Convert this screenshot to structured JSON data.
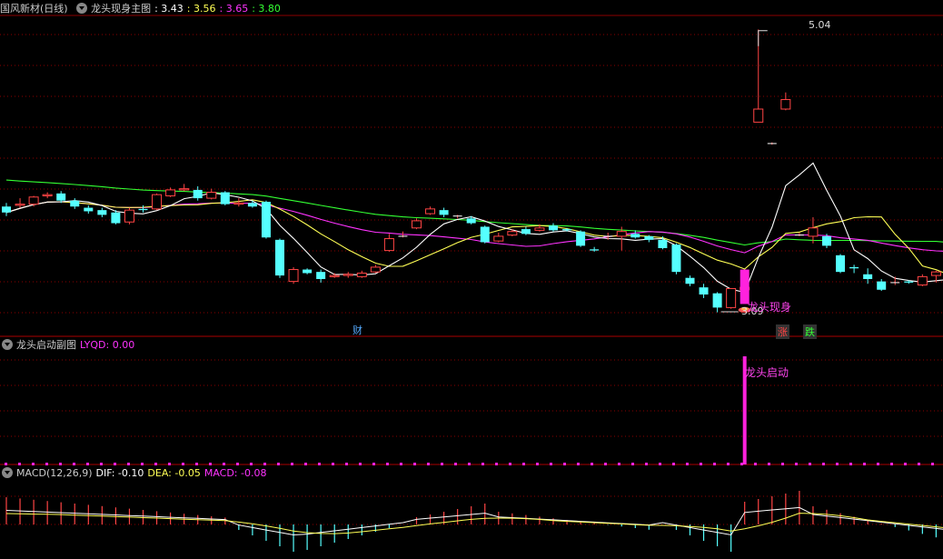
{
  "main_panel": {
    "stock_title": "国风新材(日线)",
    "indicator_name": "龙头现身主图",
    "indicator_values": [
      {
        "text": ": 3.43",
        "color": "#ffffff"
      },
      {
        "text": ": 3.56",
        "color": "#ffff55"
      },
      {
        "text": ": 3.65",
        "color": "#ff33ff"
      },
      {
        "text": ": 3.80",
        "color": "#33ff33"
      }
    ],
    "high_label": "5.04",
    "low_label": "3.09",
    "signal_label": "龙头现身",
    "markers": {
      "cai": "财",
      "zhang": "涨",
      "die": "跌"
    }
  },
  "sub_panel1": {
    "name": "龙头启动副图",
    "value_label": "LYQD: 0.00",
    "signal_label": "龙头启动"
  },
  "macd_panel": {
    "name": "MACD(12,26,9)",
    "dif": "DIF: -0.10",
    "dea": "DEA: -0.05",
    "macd": "MACD: -0.08"
  },
  "colors": {
    "up": "#ff4444",
    "down": "#55ffff",
    "ma1": "#ffffff",
    "ma2": "#ffff55",
    "ma3": "#ff33ff",
    "ma4": "#33ff33",
    "grid": "#8b0000",
    "signal": "#ff22dd"
  },
  "candles": [
    [
      3.55,
      3.5,
      3.58,
      3.47
    ],
    [
      3.56,
      3.57,
      3.62,
      3.54
    ],
    [
      3.57,
      3.63,
      3.64,
      3.55
    ],
    [
      3.64,
      3.65,
      3.67,
      3.62
    ],
    [
      3.66,
      3.6,
      3.68,
      3.58
    ],
    [
      3.6,
      3.55,
      3.62,
      3.53
    ],
    [
      3.54,
      3.51,
      3.56,
      3.49
    ],
    [
      3.52,
      3.48,
      3.54,
      3.46
    ],
    [
      3.5,
      3.41,
      3.52,
      3.4
    ],
    [
      3.42,
      3.52,
      3.54,
      3.4
    ],
    [
      3.53,
      3.52,
      3.56,
      3.5
    ],
    [
      3.53,
      3.65,
      3.66,
      3.52
    ],
    [
      3.64,
      3.69,
      3.71,
      3.63
    ],
    [
      3.69,
      3.7,
      3.74,
      3.68
    ],
    [
      3.69,
      3.62,
      3.72,
      3.6
    ],
    [
      3.62,
      3.67,
      3.7,
      3.61
    ],
    [
      3.67,
      3.57,
      3.68,
      3.56
    ],
    [
      3.57,
      3.58,
      3.62,
      3.55
    ],
    [
      3.58,
      3.55,
      3.6,
      3.54
    ],
    [
      3.59,
      3.29,
      3.6,
      3.28
    ],
    [
      3.27,
      2.97,
      3.28,
      2.95
    ],
    [
      2.92,
      3.02,
      3.04,
      2.9
    ],
    [
      3.02,
      2.99,
      3.03,
      2.98
    ],
    [
      3.0,
      2.94,
      3.02,
      2.91
    ],
    [
      2.96,
      2.97,
      2.99,
      2.95
    ],
    [
      2.97,
      2.98,
      3.0,
      2.95
    ],
    [
      2.96,
      2.99,
      3.01,
      2.95
    ],
    [
      3.0,
      3.04,
      3.06,
      2.99
    ],
    [
      3.18,
      3.28,
      3.32,
      3.17
    ],
    [
      3.3,
      3.3,
      3.34,
      3.29
    ],
    [
      3.37,
      3.43,
      3.45,
      3.36
    ],
    [
      3.49,
      3.53,
      3.55,
      3.48
    ],
    [
      3.52,
      3.48,
      3.54,
      3.46
    ],
    [
      3.47,
      3.47,
      3.48,
      3.45
    ],
    [
      3.45,
      3.41,
      3.47,
      3.4
    ],
    [
      3.38,
      3.25,
      3.39,
      3.24
    ],
    [
      3.26,
      3.3,
      3.33,
      3.25
    ],
    [
      3.31,
      3.34,
      3.36,
      3.3
    ],
    [
      3.36,
      3.32,
      3.38,
      3.31
    ],
    [
      3.35,
      3.37,
      3.4,
      3.34
    ],
    [
      3.39,
      3.35,
      3.41,
      3.34
    ],
    [
      3.36,
      3.35,
      3.37,
      3.34
    ],
    [
      3.34,
      3.22,
      3.35,
      3.21
    ],
    [
      3.19,
      3.18,
      3.21,
      3.17
    ],
    [
      3.3,
      3.3,
      3.33,
      3.27
    ],
    [
      3.3,
      3.34,
      3.38,
      3.18
    ],
    [
      3.32,
      3.29,
      3.35,
      3.28
    ],
    [
      3.3,
      3.27,
      3.31,
      3.25
    ],
    [
      3.27,
      3.2,
      3.3,
      3.19
    ],
    [
      3.23,
      3.0,
      3.24,
      2.98
    ],
    [
      2.95,
      2.9,
      2.97,
      2.88
    ],
    [
      2.87,
      2.81,
      2.9,
      2.78
    ],
    [
      2.82,
      2.7,
      2.83,
      2.66
    ],
    [
      2.7,
      2.86,
      2.86,
      2.69
    ],
    [
      2.85,
      2.87,
      3.01,
      2.84
    ],
    [
      4.26,
      4.37,
      5.04,
      4.27
    ],
    [
      4.08,
      4.08,
      4.09,
      4.07
    ],
    [
      4.37,
      4.45,
      4.51,
      4.36
    ],
    [
      3.31,
      3.31,
      3.33,
      3.3
    ],
    [
      3.3,
      3.37,
      3.46,
      3.24
    ],
    [
      3.3,
      3.22,
      3.32,
      3.2
    ],
    [
      3.14,
      3.0,
      3.15,
      2.99
    ],
    [
      3.04,
      3.03,
      3.06,
      2.99
    ],
    [
      2.98,
      2.94,
      3.03,
      2.9
    ],
    [
      2.92,
      2.85,
      2.94,
      2.84
    ],
    [
      2.91,
      2.91,
      2.96,
      2.89
    ],
    [
      2.92,
      2.91,
      2.93,
      2.9
    ],
    [
      2.89,
      2.96,
      2.98,
      2.88
    ],
    [
      2.97,
      3.0,
      3.01,
      2.91
    ],
    [
      2.99,
      2.91,
      3.02,
      2.9
    ],
    [
      2.9,
      2.92,
      2.94,
      2.89
    ]
  ]
}
